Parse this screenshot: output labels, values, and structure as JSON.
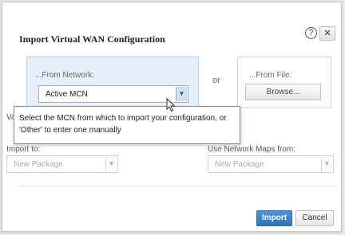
{
  "dialog": {
    "title": "Import Virtual WAN Configuration",
    "help_glyph": "?",
    "close_glyph": "✕"
  },
  "network_panel": {
    "label": "...From Network:",
    "selected": "Active MCN",
    "arrow_glyph": "▼"
  },
  "or_text": "or",
  "file_panel": {
    "label": "...From File:",
    "browse_label": "Browse..."
  },
  "tooltip": {
    "text": "Select the MCN from which to import your configuration, or 'Other' to enter one manually"
  },
  "valid_label": "Valic",
  "import_to": {
    "label": "Import to:",
    "value": "New Package",
    "arrow_glyph": "▼"
  },
  "network_maps": {
    "label": "Use Network Maps from:",
    "value": "New Package",
    "arrow_glyph": "▼"
  },
  "footer": {
    "import_label": "Import",
    "cancel_label": "Cancel"
  },
  "colors": {
    "accent": "#2f74b8",
    "panel_bg": "#e5f0fa"
  }
}
